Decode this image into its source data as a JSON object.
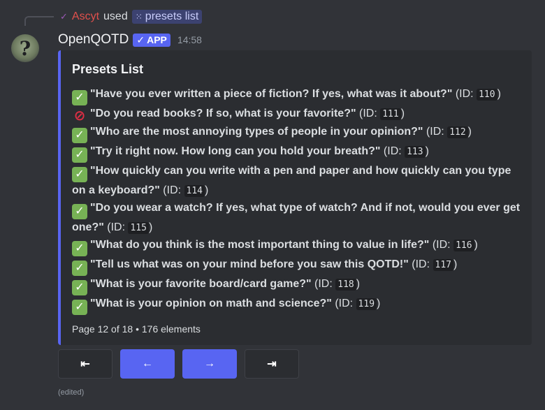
{
  "reply": {
    "user": "Ascyt",
    "used": "used",
    "command": "presets list"
  },
  "message": {
    "author": "OpenQOTD",
    "badge": "APP",
    "timestamp": "14:58",
    "edited": "(edited)"
  },
  "embed": {
    "title": "Presets List",
    "accent_color": "#5865f2",
    "items": [
      {
        "status": "check",
        "text": "\"Have you ever written a piece of fiction? If yes, what was it about?\"",
        "id_prefix": " (ID: ",
        "id": "110",
        "id_suffix": ")"
      },
      {
        "status": "prohibited",
        "text": "\"Do you read books? If so, what is your favorite?\"",
        "id_prefix": " (ID: ",
        "id": "111",
        "id_suffix": ")"
      },
      {
        "status": "check",
        "text": "\"Who are the most annoying types of people in your opinion?\"",
        "id_prefix": " (ID: ",
        "id": "112",
        "id_suffix": ")"
      },
      {
        "status": "check",
        "text": "\"Try it right now. How long can you hold your breath?\"",
        "id_prefix": " (ID: ",
        "id": "113",
        "id_suffix": ")"
      },
      {
        "status": "check",
        "text": "\"How quickly can you write with a pen and paper and how quickly can you type on a keyboard?\"",
        "id_prefix": " (ID: ",
        "id": "114",
        "id_suffix": ")"
      },
      {
        "status": "check",
        "text": "\"Do you wear a watch? If yes, what type of watch? And if not, would you ever get one?\"",
        "id_prefix": " (ID: ",
        "id": "115",
        "id_suffix": ")"
      },
      {
        "status": "check",
        "text": "\"What do you think is the most important thing to value in life?\"",
        "id_prefix": " (ID: ",
        "id": "116",
        "id_suffix": ")"
      },
      {
        "status": "check",
        "text": "\"Tell us what was on your mind before you saw this QOTD!\"",
        "id_prefix": " (ID: ",
        "id": "117",
        "id_suffix": ")"
      },
      {
        "status": "check",
        "text": "\"What is your favorite board/card game?\"",
        "id_prefix": " (ID: ",
        "id": "118",
        "id_suffix": ")"
      },
      {
        "status": "check",
        "text": "\"What is your opinion on math and science?\"",
        "id_prefix": " (ID: ",
        "id": "119",
        "id_suffix": ")"
      }
    ],
    "footer": "Page 12 of 18 • 176 elements"
  },
  "buttons": {
    "first": "⇤",
    "prev": "←",
    "next": "→",
    "last": "⇥"
  }
}
